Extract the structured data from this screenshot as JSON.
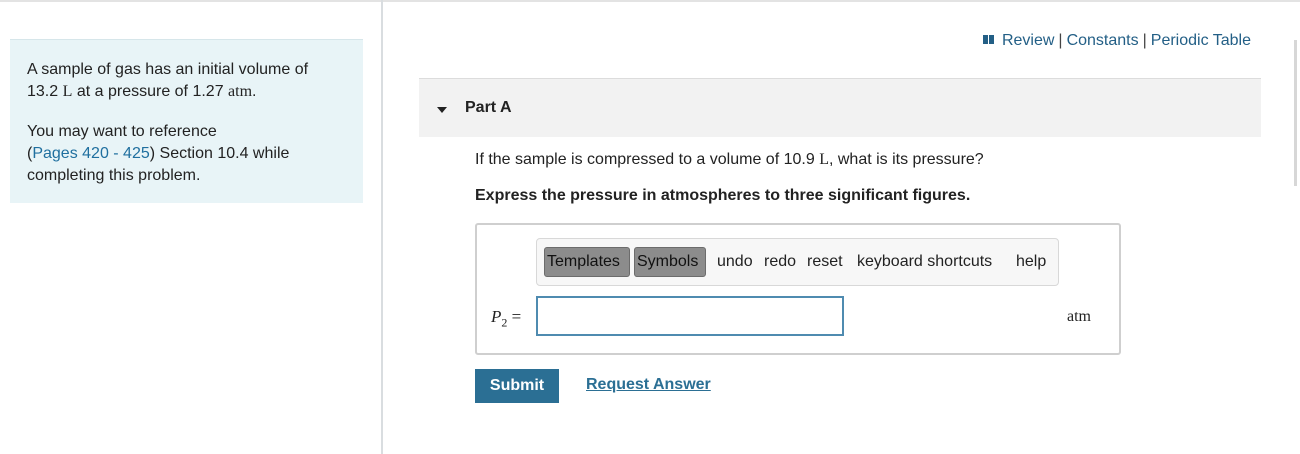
{
  "intro": {
    "line1_prefix": "A sample of gas has an initial volume of",
    "line2_value": "13.2",
    "line2_unit_L": "L",
    "line2_mid": "at a pressure of 1.27",
    "line2_unit_atm": "atm",
    "line2_end": ".",
    "ref_prefix": "You may want to reference",
    "ref_link": "Pages 420 - 425",
    "ref_suffix": "Section 10.4 while completing this problem."
  },
  "toplinks": {
    "review": "Review",
    "constants": "Constants",
    "periodic": "Periodic Table",
    "separator": "|"
  },
  "part": {
    "title": "Part A"
  },
  "question": {
    "prefix": "If the sample is compressed to a volume of 10.9",
    "unit": "L",
    "suffix": ", what is its pressure?"
  },
  "instruction": "Express the pressure in atmospheres to three significant figures.",
  "toolbar": {
    "templates": "Templates",
    "symbols": "Symbols",
    "undo": "undo",
    "redo": "redo",
    "reset": "reset",
    "shortcuts": "keyboard shortcuts",
    "help": "help"
  },
  "answer": {
    "label_main": "P",
    "label_sub": "2",
    "label_eq": "=",
    "value": "",
    "unit": "atm"
  },
  "actions": {
    "submit": "Submit",
    "request": "Request Answer"
  }
}
